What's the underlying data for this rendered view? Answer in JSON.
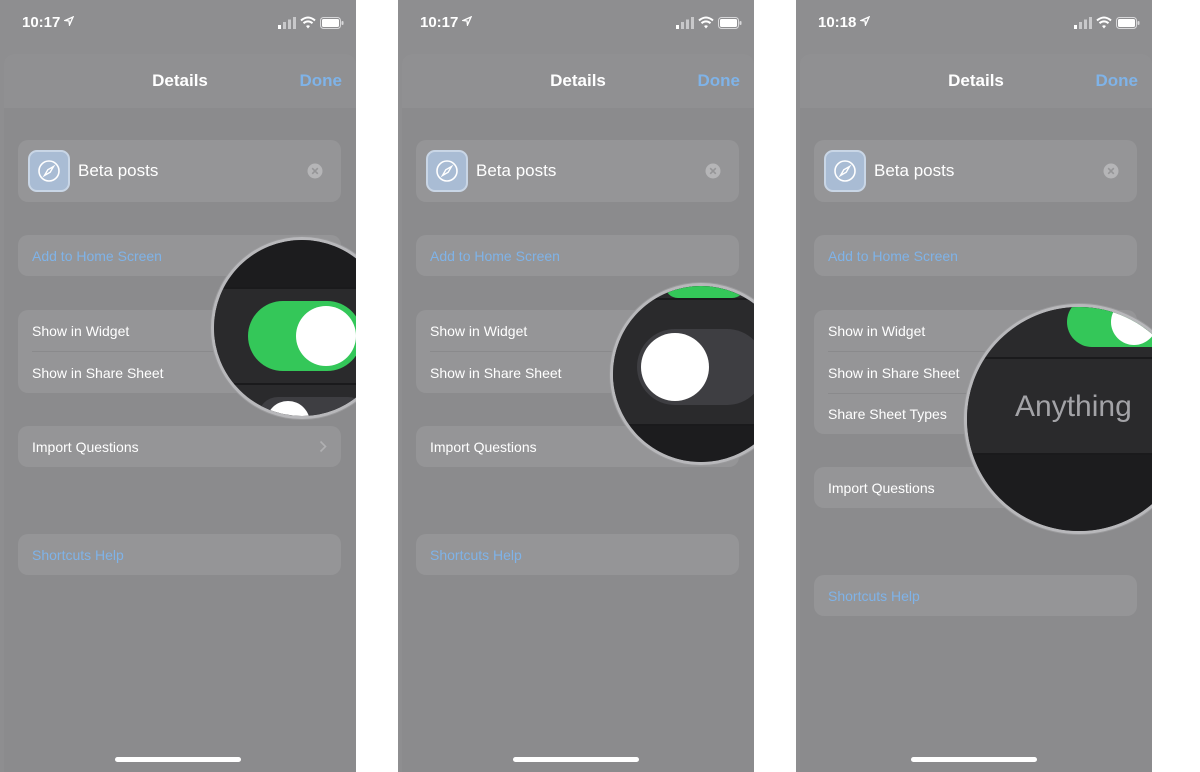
{
  "colors": {
    "accent": "#7fb3e8",
    "toggle_on": "#34c759",
    "toggle_off": "#3e3e42",
    "lens_bg": "#2a2a2c"
  },
  "screens": [
    {
      "status": {
        "time": "10:17"
      },
      "nav": {
        "title": "Details",
        "done": "Done"
      },
      "shortcut_name": "Beta posts",
      "add_home": "Add to Home Screen",
      "show_widget": "Show in Widget",
      "show_share": "Show in Share Sheet",
      "import_questions": "Import Questions",
      "help": "Shortcuts Help",
      "zoom": {
        "subject": "Show in Widget toggle",
        "state": "on"
      }
    },
    {
      "status": {
        "time": "10:17"
      },
      "nav": {
        "title": "Details",
        "done": "Done"
      },
      "shortcut_name": "Beta posts",
      "add_home": "Add to Home Screen",
      "show_widget": "Show in Widget",
      "show_share": "Show in Share Sheet",
      "import_questions": "Import Questions",
      "help": "Shortcuts Help",
      "zoom": {
        "subject": "Show in Share Sheet toggle",
        "state": "off"
      }
    },
    {
      "status": {
        "time": "10:18"
      },
      "nav": {
        "title": "Details",
        "done": "Done"
      },
      "shortcut_name": "Beta posts",
      "add_home": "Add to Home Screen",
      "show_widget": "Show in Widget",
      "show_share": "Show in Share Sheet",
      "share_types": "Share Sheet Types",
      "import_questions": "Import Questions",
      "help": "Shortcuts Help",
      "zoom": {
        "value": "Anything"
      }
    }
  ]
}
